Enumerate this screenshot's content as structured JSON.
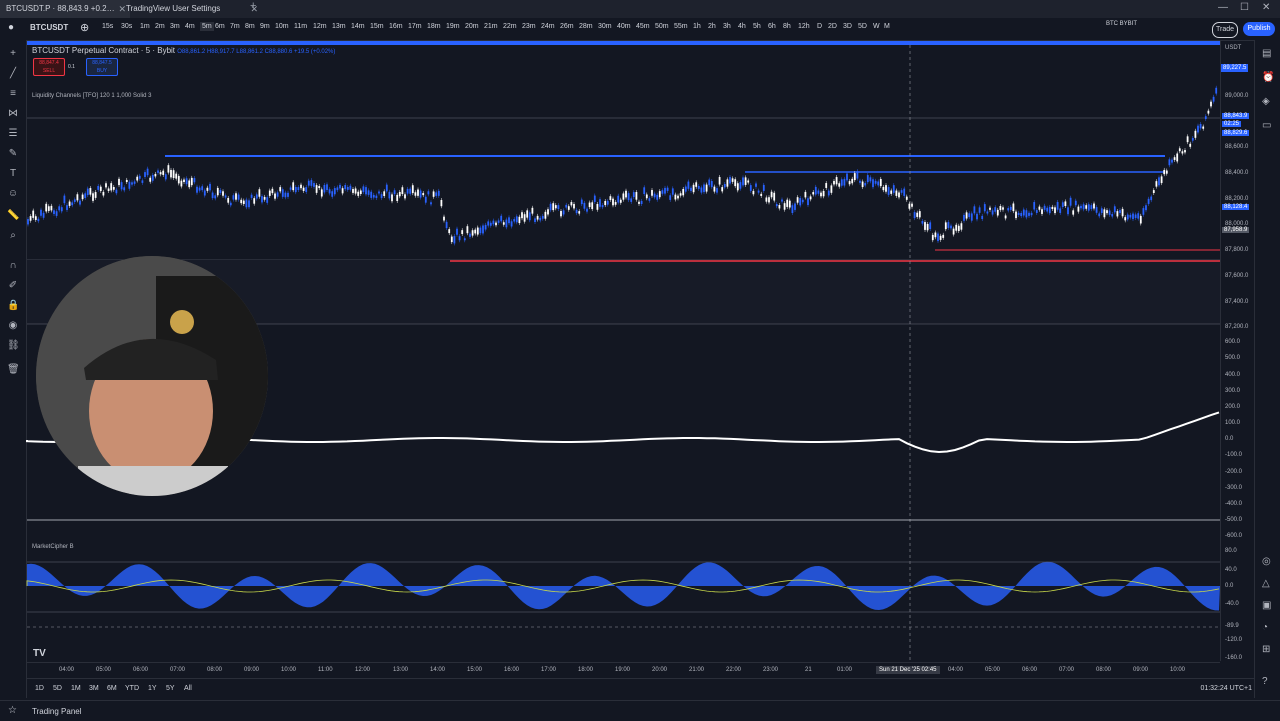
{
  "browser": {
    "tab1_title": "BTCUSDT.P · 88,843.9 +0.2…",
    "tab2_title": "TradingView User Settings"
  },
  "toolbar": {
    "symbol": "BTCUSDT",
    "timeframes": [
      "15s",
      "30s",
      "1m",
      "2m",
      "3m",
      "4m",
      "5m",
      "6m",
      "7m",
      "8m",
      "9m",
      "10m",
      "11m",
      "12m",
      "13m",
      "14m",
      "15m",
      "16m",
      "17m",
      "18m",
      "19m",
      "20m",
      "21m",
      "22m",
      "23m",
      "24m",
      "26m",
      "28m",
      "30m",
      "40m",
      "45m",
      "50m",
      "55m",
      "1h",
      "2h",
      "3h",
      "4h",
      "5h",
      "6h",
      "8h",
      "12h",
      "D",
      "2D",
      "3D",
      "5D",
      "W",
      "M"
    ],
    "active_timeframe": "5m",
    "broker": "BTC BYBIT",
    "broker_sub": "Bybit",
    "trade_label": "Trade",
    "publish_label": "Publish"
  },
  "legend": {
    "title": "BTCUSDT Perpetual Contract · 5 · Bybit",
    "ohlc": "O88,861.2 H88,917.7 L88,861.2 C88,880.6 +19.5 (+0.02%)",
    "sell_price": "88,847.4",
    "sell_label": "SELL",
    "spread": "0.1",
    "buy_price": "88,847.5",
    "buy_label": "BUY",
    "indicator": "Liquidity Channels [TFO] 120 1 1,000 Solid 3",
    "lower_indicator": "MarketCipher B"
  },
  "price_axis": {
    "currency": "USDT",
    "labels": [
      "89,000.0",
      "88,600.0",
      "88,400.0",
      "88,200.0",
      "88,000.0",
      "87,800.0",
      "87,600.0",
      "87,400.0",
      "87,200.0"
    ],
    "last_price": "89,227.5",
    "current_price": "88,843.9",
    "countdown": "02:25",
    "price_88829": "88,829.6",
    "price_88128": "88,128.4",
    "price_87958": "87,958.9"
  },
  "osc_axis": [
    "600.0",
    "500.0",
    "400.0",
    "300.0",
    "200.0",
    "100.0",
    "0.0",
    "-100.0",
    "-200.0",
    "-300.0",
    "-400.0",
    "-500.0",
    "-600.0"
  ],
  "mc_axis": [
    "80.0",
    "40.0",
    "0.0",
    "-40.0",
    "-89.9",
    "-120.0",
    "-160.0"
  ],
  "time_axis": [
    "04:00",
    "05:00",
    "06:00",
    "07:00",
    "08:00",
    "09:00",
    "10:00",
    "11:00",
    "12:00",
    "13:00",
    "14:00",
    "15:00",
    "16:00",
    "17:00",
    "18:00",
    "19:00",
    "20:00",
    "21:00",
    "22:00",
    "23:00",
    "21",
    "01:00",
    "04:00",
    "05:00",
    "06:00",
    "07:00",
    "08:00",
    "09:00",
    "10:00"
  ],
  "crosshair_time": "Sun 21 Dec '25  02:45",
  "bottom": {
    "ranges": [
      "1D",
      "5D",
      "1M",
      "3M",
      "6M",
      "YTD",
      "1Y",
      "5Y",
      "All"
    ],
    "clock": "01:32:24 UTC+1",
    "trading_panel": "Trading Panel"
  },
  "colors": {
    "background": "#131722",
    "up_candle": "#ffffff",
    "down_candle": "#2962ff",
    "support_line": "#f23645",
    "accent": "#2962ff"
  }
}
